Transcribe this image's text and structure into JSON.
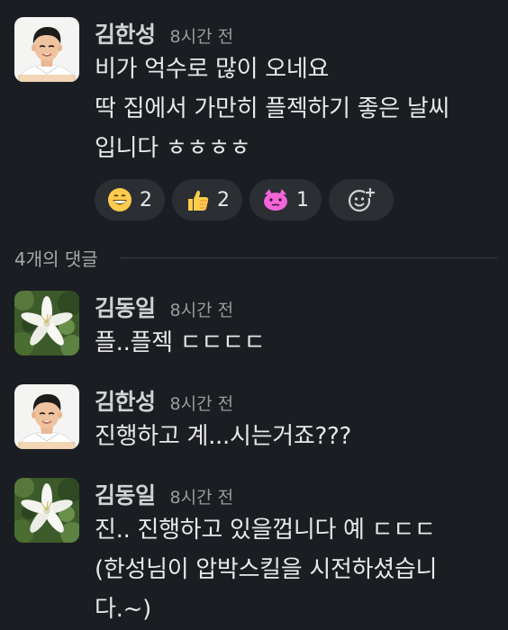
{
  "messages": [
    {
      "author": "김한성",
      "time": "8시간 전",
      "lines": [
        "비가 억수로 많이 오네요",
        "딱 집에서 가만히 플젝하기 좋은 날씨",
        "입니다 ㅎㅎㅎㅎ"
      ],
      "reactions": [
        {
          "icon": "grinning-face-icon",
          "count": "2"
        },
        {
          "icon": "thumbs-up-icon",
          "count": "2"
        },
        {
          "icon": "pink-cat-emoji-icon",
          "count": "1"
        }
      ]
    }
  ],
  "thread": {
    "reply_count_label": "4개의 댓글"
  },
  "replies": [
    {
      "author": "김동일",
      "time": "8시간 전",
      "avatar": "white-flower-photo",
      "lines": [
        "플..플젝 ㄷㄷㄷㄷ"
      ]
    },
    {
      "author": "김한성",
      "time": "8시간 전",
      "avatar": "man-portrait-photo",
      "lines": [
        "진행하고 계...시는거죠???"
      ]
    },
    {
      "author": "김동일",
      "time": "8시간 전",
      "avatar": "white-flower-photo",
      "lines": [
        "진.. 진행하고 있을껍니다 예 ㄷㄷㄷ",
        "(한성님이 압박스킬을 시전하셨습니",
        "다.~)"
      ]
    }
  ]
}
